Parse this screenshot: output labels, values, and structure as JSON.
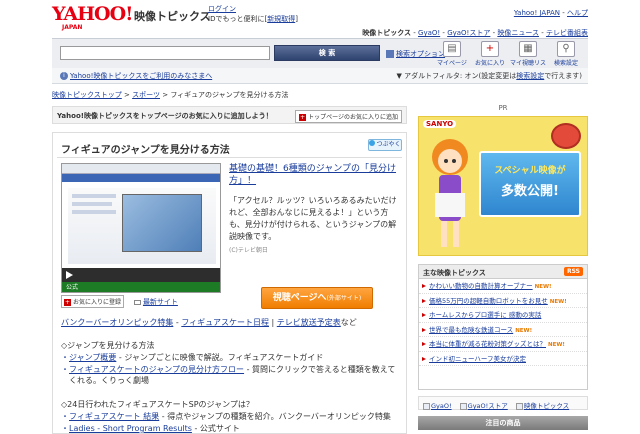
{
  "header": {
    "logo": "YAHOO!",
    "logo_sub": "JAPAN",
    "service_name": "映像トピックス",
    "login_label": "ログイン",
    "login_desc": "IDでもっと便利に[",
    "register_label": "新規取得",
    "register_close": "]",
    "yahoo_japan_link": "Yahoo! JAPAN",
    "help_link": "ヘルプ",
    "subnav": {
      "current": "映像トピックス",
      "gyao": "GyaO!",
      "gyao_store": "GyaO!ストア",
      "eizo_news": "映像ニュース",
      "tv_guide": "テレビ番組表"
    }
  },
  "search": {
    "input_value": "",
    "button_label": "検 索",
    "option_label": "検索オプション"
  },
  "tools": [
    {
      "label": "マイページ",
      "icon": "mypage-icon",
      "glyph": "▤"
    },
    {
      "label": "お気に入り",
      "icon": "favorite-icon",
      "glyph": "+"
    },
    {
      "label": "マイ視聴リスト",
      "icon": "playlist-icon",
      "glyph": "▦"
    },
    {
      "label": "検索設定",
      "icon": "search-settings-icon",
      "glyph": "⚲"
    }
  ],
  "info": {
    "notice": "Yahoo!映像トピックスをご利用のみなさまへ",
    "adult_filter_prefix": "▼ アダルトフィルタ: オン(設定変更は",
    "adult_filter_link": "検索設定",
    "adult_filter_suffix": "で行えます)"
  },
  "breadcrumb": {
    "home": "映像トピックストップ",
    "sep1": " > ",
    "sports": "スポーツ",
    "current": " > フィギュアのジャンプを見分ける方法"
  },
  "addbar": {
    "text": "Yahoo!映像トピックスをトップページのお気に入りに追加しよう！",
    "button": "トップページのお気に入りに追加"
  },
  "article": {
    "title": "フィギュアのジャンプを見分ける方法",
    "share_label": "つぶやく",
    "thumb_footer": "公式",
    "favorite_btn": "お気に入りに登録",
    "mail_link": "最新サイト",
    "link_title": "基礎の基礎！6種類のジャンプの「見分け方」！",
    "description": "「アクセル？ルッツ？いろいろあるみたいだけれど、全部おんなじに見えるよ！」という方も、見分けが付けられる、というジャンプの解説映像です。",
    "credit": "(C)テレビ朝日",
    "watch_button": "視聴ページへ",
    "watch_button_sub": "(外部サイト)",
    "related": {
      "l1": "バンクーバーオリンピック特集",
      "sep": " - ",
      "l2": "フィギュアスケート日程",
      "sep2": " | ",
      "l3": "テレビ放送予定表",
      "suffix": "など"
    },
    "sec1_head": "◇ジャンプを見分ける方法",
    "sec1_item1_link": "ジャンプ概要",
    "sec1_item1_text": " - ジャンプごとに映像で解説。フィギュアスケートガイド",
    "sec1_item2_link": "フィギュアスケートのジャンプの見分け方フロー",
    "sec1_item2_text": " - 質問にクリックで答えると種類を教えて",
    "sec1_item2_text2": "くれる。くりっく劇場",
    "sec2_head": "◇24日行われたフィギュアスケートSPのジャンプは？",
    "sec2_item1_link": "フィギュアスケート 結果",
    "sec2_item1_text": " - 得点やジャンプの種類を紹介。バンクーバーオリンピック特集",
    "sec2_item2_link": "Ladies - Short Program Results",
    "sec2_item2_text": " - 公式サイト"
  },
  "sidebar": {
    "pr_label": "PR",
    "ad": {
      "brand": "SANYO",
      "line1": "スペシャル映像が",
      "line2": "多数公開!"
    },
    "topics_title": "主な映像トピックス",
    "rss_label": "RSS",
    "new_label": "NEW!",
    "topics": [
      {
        "text": "かわいい動物の自動計算オーブナー",
        "is_new": true
      },
      {
        "text": "価格55万円の超軽自動ロボットをお見せ",
        "is_new": true
      },
      {
        "text": "ホームレスからプロ選手に 感動の実話",
        "is_new": false
      },
      {
        "text": "世界で最も危険な鉄道コース",
        "is_new": true
      },
      {
        "text": "本当に体重が減る花粉対策グッズとは？",
        "is_new": true
      },
      {
        "text": "インド初ニューハーフ美女が決定",
        "is_new": false
      }
    ],
    "service_links": [
      {
        "label": "GyaO!",
        "icon": "gyao-icon"
      },
      {
        "label": "GyaO!ストア",
        "icon": "gyao-store-icon"
      },
      {
        "label": "映像トピックス",
        "icon": "eizo-topics-icon"
      }
    ],
    "products_header": "注目の商品"
  },
  "colors": {
    "link": "#1a3d9c",
    "yahoo_red": "#e60012",
    "watch_orange": "#f07d00",
    "ad_yellow": "#f7e26b"
  }
}
